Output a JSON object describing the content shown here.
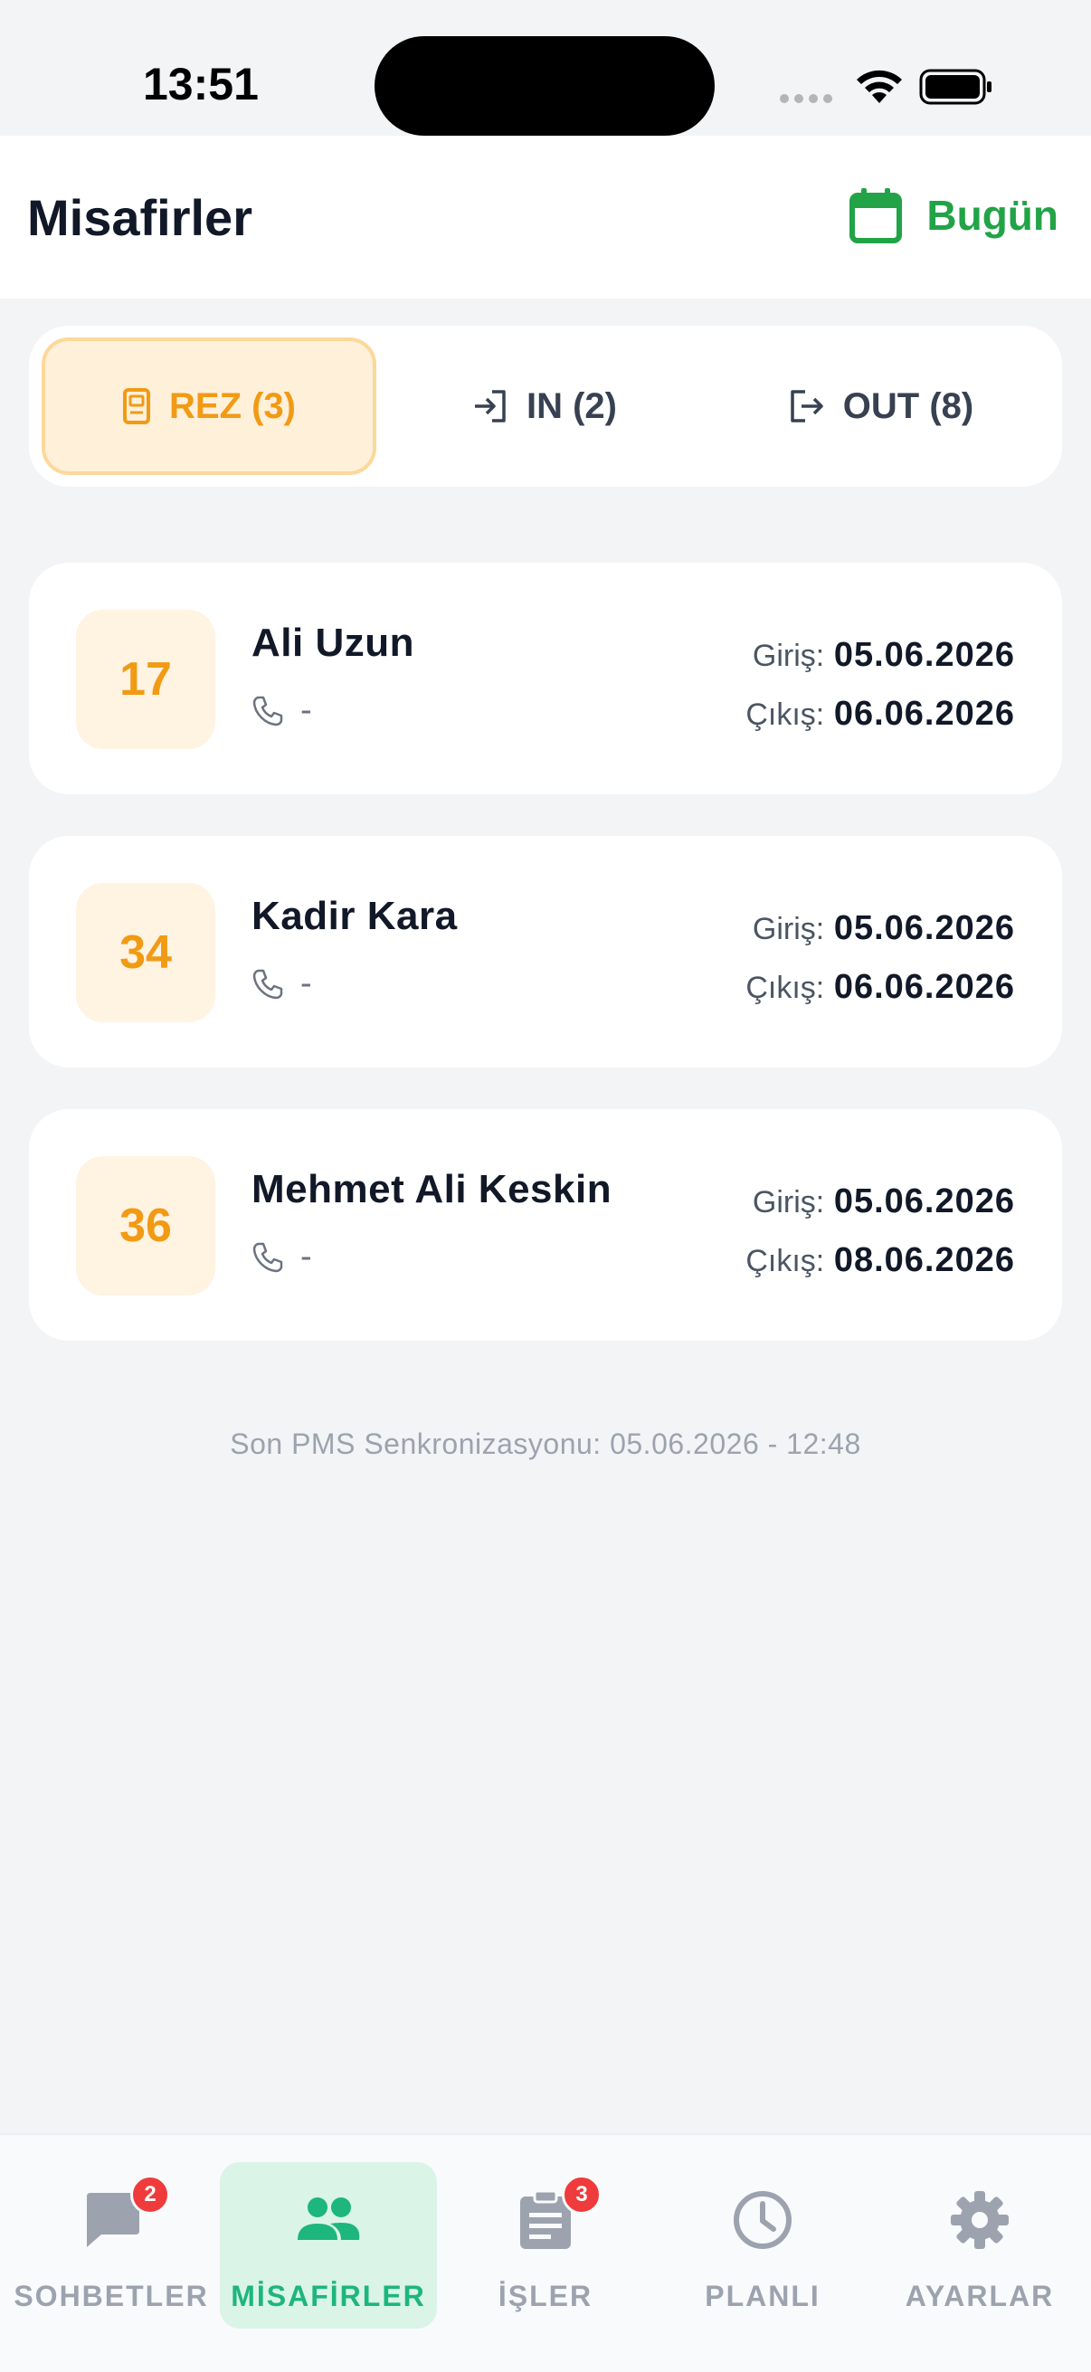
{
  "status_bar": {
    "time": "13:51"
  },
  "header": {
    "title": "Misafirler",
    "today_label": "Bugün"
  },
  "tabs": [
    {
      "label": "REZ (3)",
      "icon": "reservation-icon",
      "active": true
    },
    {
      "label": "IN (2)",
      "icon": "login-icon",
      "active": false
    },
    {
      "label": "OUT (8)",
      "icon": "logout-icon",
      "active": false
    }
  ],
  "guests": [
    {
      "room": "17",
      "name": "Ali Uzun",
      "phone": "-",
      "checkin_label": "Giriş:",
      "checkin": "05.06.2026",
      "checkout_label": "Çıkış:",
      "checkout": "06.06.2026"
    },
    {
      "room": "34",
      "name": "Kadir Kara",
      "phone": "-",
      "checkin_label": "Giriş:",
      "checkin": "05.06.2026",
      "checkout_label": "Çıkış:",
      "checkout": "06.06.2026"
    },
    {
      "room": "36",
      "name": "Mehmet Ali Keskin",
      "phone": "-",
      "checkin_label": "Giriş:",
      "checkin": "05.06.2026",
      "checkout_label": "Çıkış:",
      "checkout": "08.06.2026"
    }
  ],
  "sync_note": "Son PMS Senkronizasyonu: 05.06.2026 - 12:48",
  "tabbar": [
    {
      "label": "SOHBETLER",
      "icon": "chat-icon",
      "badge": "2",
      "active": false
    },
    {
      "label": "MİSAFİRLER",
      "icon": "guests-icon",
      "badge": "",
      "active": true
    },
    {
      "label": "İŞLER",
      "icon": "tasks-icon",
      "badge": "3",
      "active": false
    },
    {
      "label": "PLANLI",
      "icon": "clock-icon",
      "badge": "",
      "active": false
    },
    {
      "label": "AYARLAR",
      "icon": "settings-icon",
      "badge": "",
      "active": false
    }
  ],
  "colors": {
    "accent_green": "#22a347",
    "active_orange": "#f19a14",
    "tab_active_green": "#1db67c",
    "badge_red": "#ef3b3b"
  }
}
